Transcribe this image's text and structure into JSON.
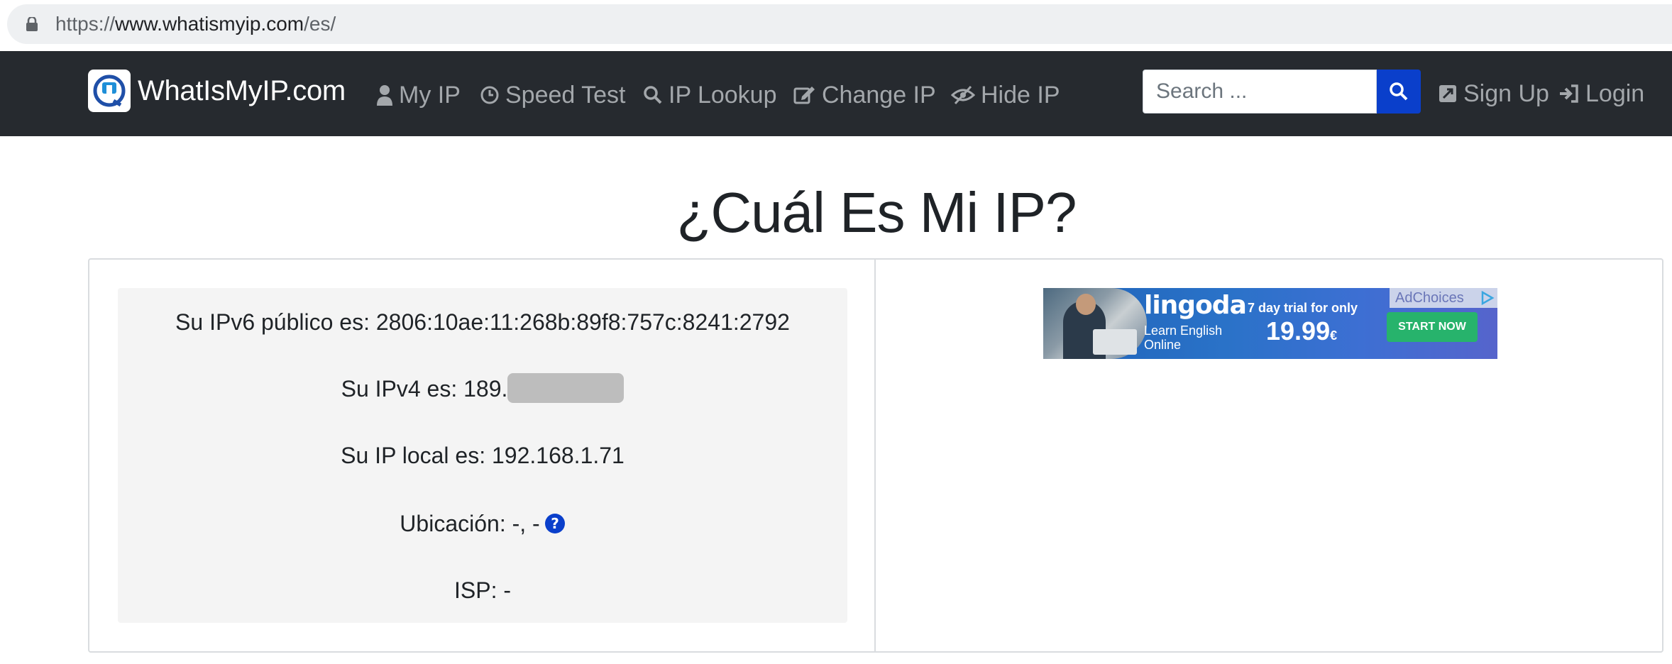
{
  "browser": {
    "url_scheme": "https://",
    "url_host": "www.whatismyip.com",
    "url_path": "/es/"
  },
  "navbar": {
    "brand": "WhatIsMyIP.com",
    "items": [
      {
        "label": "My IP",
        "icon": "user-icon"
      },
      {
        "label": "Speed Test",
        "icon": "clock-icon"
      },
      {
        "label": "IP Lookup",
        "icon": "search-icon"
      },
      {
        "label": "Change IP",
        "icon": "edit-icon"
      },
      {
        "label": "Hide IP",
        "icon": "eye-slash-icon"
      }
    ],
    "search_placeholder": "Search ...",
    "signup": "Sign Up",
    "login": "Login",
    "colors": {
      "background": "#262a2f",
      "search_button": "#0a3fcb",
      "link": "#a3a7ab"
    }
  },
  "main": {
    "title": "¿Cuál Es Mi IP?",
    "ipv6_label": "Su IPv6 público es: 2806:10ae:11:268b:89f8:757c:8241:2792",
    "ipv4_label": "Su IPv4 es: 189.",
    "local_ip_label": "Su IP local es: 192.168.1.71",
    "location_label": "Ubicación: -, -",
    "isp_label": "ISP: -"
  },
  "ad": {
    "brand": "lingoda",
    "tagline_1": "Learn English",
    "tagline_2": "Online",
    "offer": "7 day trial for only",
    "price": "19.99",
    "currency": "€",
    "adchoices": "AdChoices",
    "cta": "START NOW"
  }
}
